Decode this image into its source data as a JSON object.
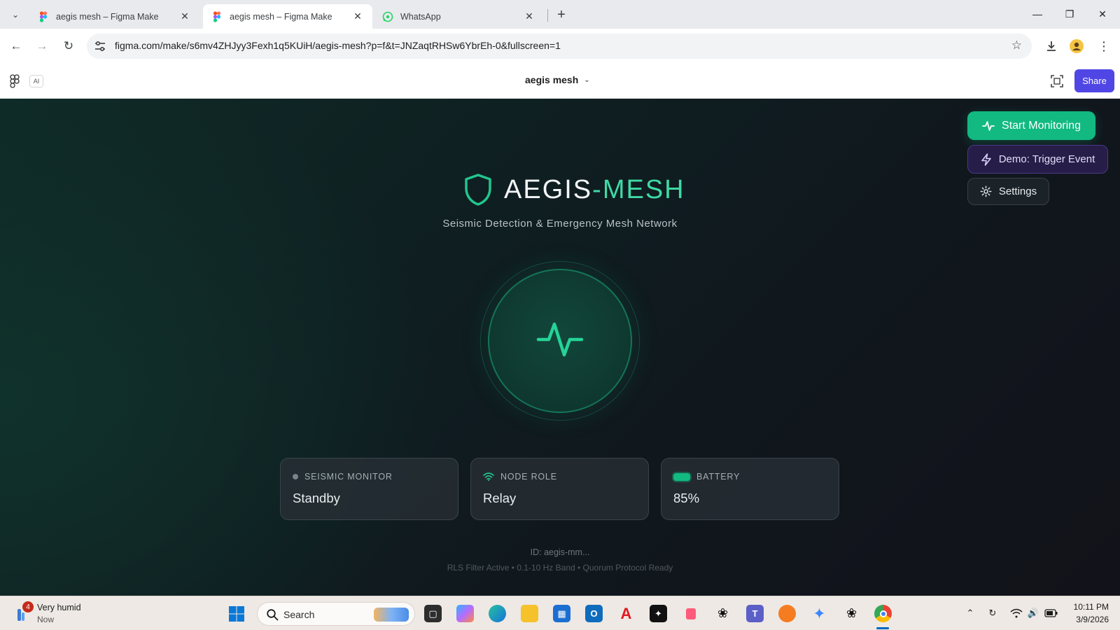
{
  "browser": {
    "tabs": [
      {
        "title": "aegis mesh – Figma Make",
        "active": false
      },
      {
        "title": "aegis mesh – Figma Make",
        "active": true
      },
      {
        "title": "WhatsApp",
        "active": false
      }
    ],
    "url": "figma.com/make/s6mv4ZHJyy3Fexh1q5KUiH/aegis-mesh?p=f&t=JNZaqtRHSw6YbrEh-0&fullscreen=1"
  },
  "figma": {
    "ai_label": "AI",
    "file_title": "aegis mesh",
    "share_label": "Share"
  },
  "app": {
    "actions": {
      "start": "Start Monitoring",
      "demo": "Demo: Trigger Event",
      "settings": "Settings"
    },
    "brand": {
      "name": "AEGIS",
      "separator": "-",
      "accent": "MESH",
      "accent_color": "#3fd9a4"
    },
    "subtitle": "Seismic Detection & Emergency Mesh Network",
    "cards": [
      {
        "label": "SEISMIC MONITOR",
        "value": "Standby",
        "icon": "status-dot-icon"
      },
      {
        "label": "NODE ROLE",
        "value": "Relay",
        "icon": "wifi-icon"
      },
      {
        "label": "BATTERY",
        "value": "85%",
        "icon": "battery-icon"
      }
    ],
    "footer": {
      "id": "ID: aegis-mm...",
      "note": "RLS Filter Active • 0.1-10 Hz Band • Quorum Protocol Ready"
    },
    "colors": {
      "primary": "#12b981",
      "demo": "#261d48",
      "share": "#4f46e5"
    }
  },
  "taskbar": {
    "weather": {
      "title": "Very humid",
      "subtitle": "Now",
      "badge": "4"
    },
    "search_label": "Search",
    "time": "10:11 PM",
    "date": "3/9/2026"
  }
}
